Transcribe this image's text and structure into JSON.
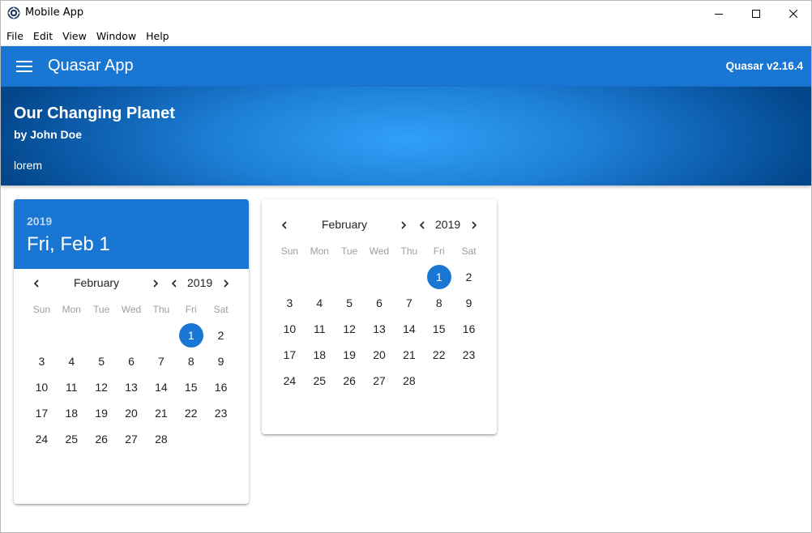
{
  "window": {
    "title": "Mobile App"
  },
  "menubar": {
    "items": [
      "File",
      "Edit",
      "View",
      "Window",
      "Help"
    ]
  },
  "header": {
    "title": "Quasar App",
    "version": "Quasar v2.16.4"
  },
  "banner": {
    "title": "Our Changing Planet",
    "subtitle": "by John Doe",
    "text": "lorem"
  },
  "picker1": {
    "year": "2019",
    "date": "Fri, Feb 1",
    "month_label": "February",
    "year_label": "2019"
  },
  "picker2": {
    "month_label": "February",
    "year_label": "2019"
  },
  "weekdays": [
    "Sun",
    "Mon",
    "Tue",
    "Wed",
    "Thu",
    "Fri",
    "Sat"
  ],
  "calendar": {
    "selected": "1",
    "weeks": [
      [
        "",
        "",
        "",
        "",
        "",
        "1",
        "2"
      ],
      [
        "3",
        "4",
        "5",
        "6",
        "7",
        "8",
        "9"
      ],
      [
        "10",
        "11",
        "12",
        "13",
        "14",
        "15",
        "16"
      ],
      [
        "17",
        "18",
        "19",
        "20",
        "21",
        "22",
        "23"
      ],
      [
        "24",
        "25",
        "26",
        "27",
        "28",
        "",
        ""
      ]
    ]
  },
  "colors": {
    "primary": "#1976d2",
    "banner_center": "#31a0f8",
    "banner_edge": "#03468a"
  }
}
